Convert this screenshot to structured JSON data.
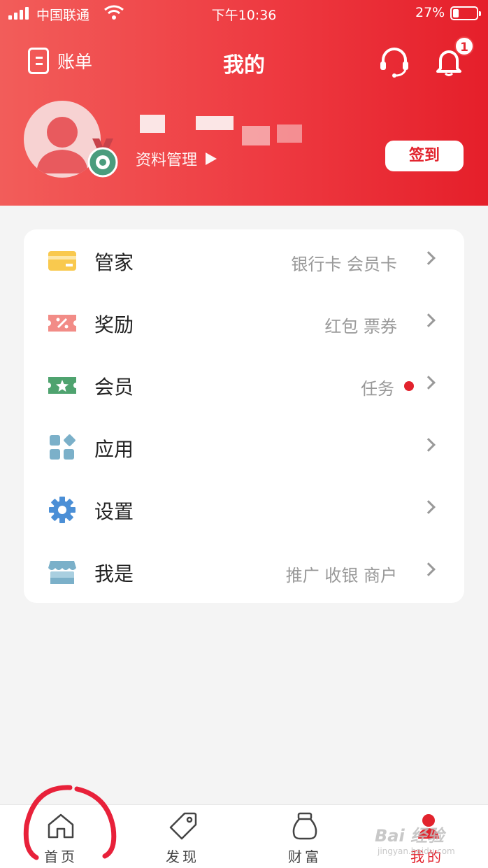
{
  "status_bar": {
    "carrier": "中国联通",
    "time": "下午10:36",
    "battery": "27%"
  },
  "header": {
    "bill_label": "账单",
    "title": "我的",
    "notification_count": "1"
  },
  "profile": {
    "subtitle": "资料管理",
    "checkin_label": "签到"
  },
  "menu": {
    "items": [
      {
        "label": "管家",
        "sub": "银行卡 会员卡",
        "icon": "card-icon",
        "color": "#f9c94e"
      },
      {
        "label": "奖励",
        "sub": "红包 票券",
        "icon": "coupon-icon",
        "color": "#f28c87"
      },
      {
        "label": "会员",
        "sub": "任务",
        "icon": "member-ticket-icon",
        "color": "#4fa36f"
      },
      {
        "label": "应用",
        "sub": "",
        "icon": "apps-grid-icon",
        "color": "#7bb0c9"
      },
      {
        "label": "设置",
        "sub": "",
        "icon": "gear-icon",
        "color": "#4b8fd6"
      },
      {
        "label": "我是",
        "sub": "推广 收银 商户",
        "icon": "store-icon",
        "color": "#7bb0c9"
      }
    ]
  },
  "tabbar": {
    "tabs": [
      {
        "label": "首页",
        "icon": "home-icon"
      },
      {
        "label": "发现",
        "icon": "tag-icon"
      },
      {
        "label": "财富",
        "icon": "money-bag-icon"
      },
      {
        "label": "我的",
        "icon": "user-icon"
      }
    ],
    "active": "我的"
  },
  "watermark": {
    "text": "Bai 经验",
    "sub": "jingyan.baidu.com"
  },
  "colors": {
    "accent": "#e2232d",
    "header_start": "#f25d5a",
    "header_end": "#e51f2a"
  }
}
